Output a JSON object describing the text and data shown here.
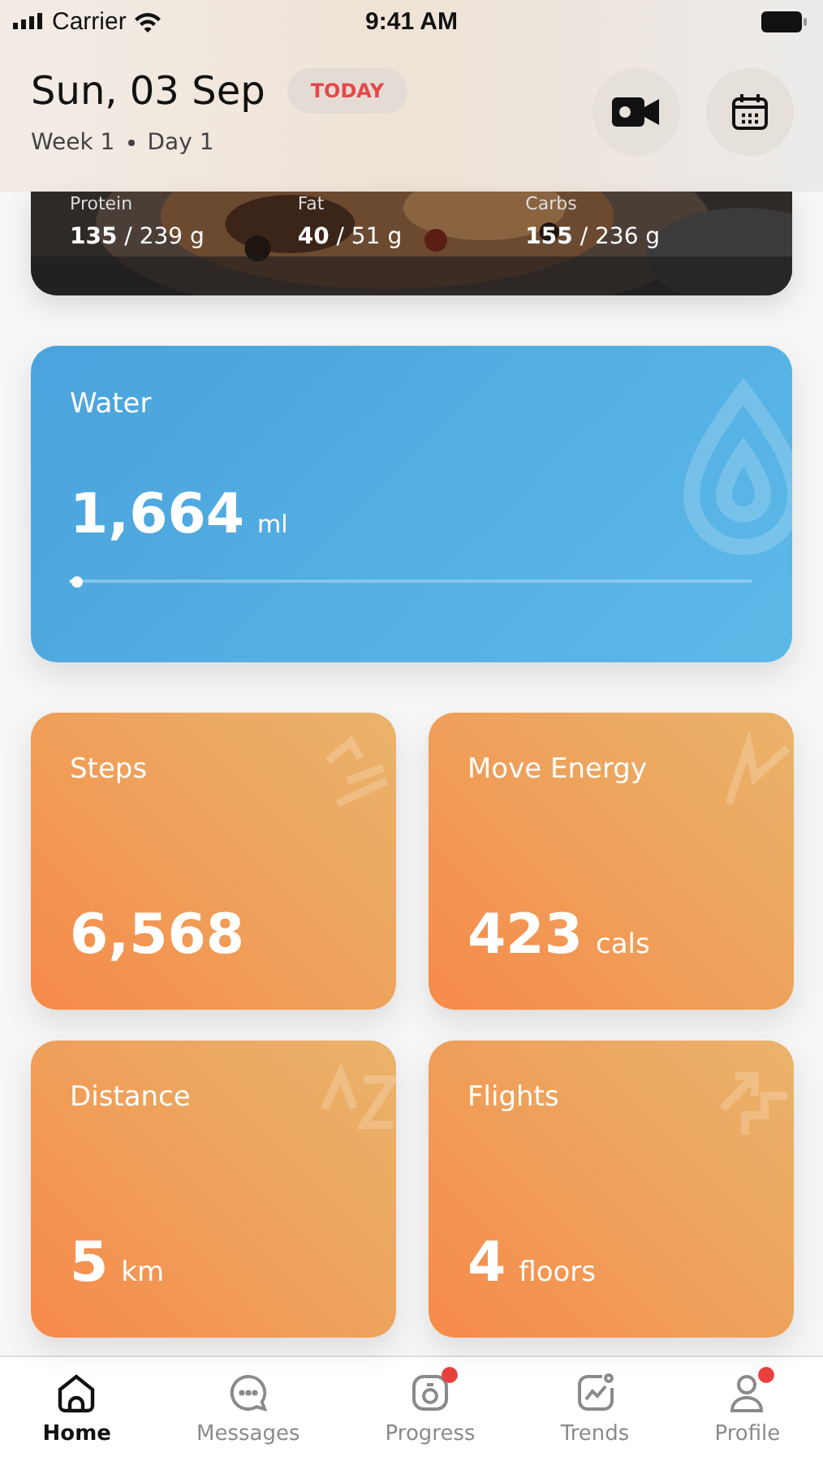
{
  "status_bar": {
    "carrier": "Carrier",
    "time": "9:41 AM"
  },
  "header": {
    "date": "Sun, 03 Sep",
    "badge": "TODAY",
    "subtitle_week": "Week 1",
    "subtitle_day": "Day 1"
  },
  "macros": [
    {
      "label": "Protein",
      "value": "135",
      "target": "/ 239 g"
    },
    {
      "label": "Fat",
      "value": "40",
      "target": "/ 51 g"
    },
    {
      "label": "Carbs",
      "value": "155",
      "target": "/ 236 g"
    }
  ],
  "water": {
    "title": "Water",
    "value": "1,664",
    "unit": "ml",
    "level": 0.01
  },
  "tiles": [
    {
      "title": "Steps",
      "value": "6,568",
      "kind": "steps"
    },
    {
      "title": "Move Energy",
      "value": "423",
      "unit": "cals",
      "kind": "energy"
    },
    {
      "title": "Distance",
      "value": "5",
      "unit": "km",
      "kind": "distance"
    },
    {
      "title": "Flights",
      "value": "4",
      "unit": "floors",
      "kind": "flights"
    }
  ],
  "tabs": [
    {
      "label": "Home",
      "kind": "home",
      "selected": true,
      "badge": false
    },
    {
      "label": "Messages",
      "kind": "messages",
      "selected": false,
      "badge": false
    },
    {
      "label": "Progress",
      "kind": "progress",
      "selected": false,
      "badge": true
    },
    {
      "label": "Trends",
      "kind": "trends",
      "selected": false,
      "badge": false
    },
    {
      "label": "Profile",
      "kind": "profile",
      "selected": false,
      "badge": true
    }
  ]
}
